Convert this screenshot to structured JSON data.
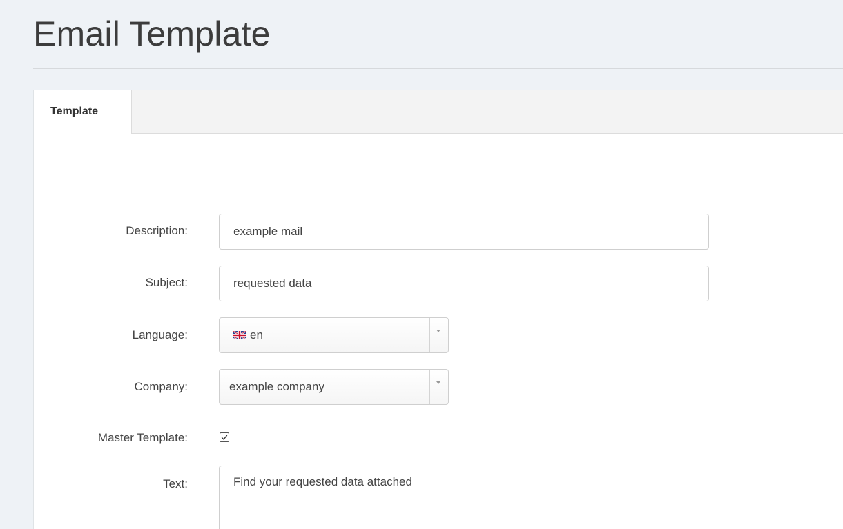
{
  "page": {
    "title": "Email Template"
  },
  "tabs": [
    {
      "label": "Template",
      "active": true
    }
  ],
  "form": {
    "description": {
      "label": "Description:",
      "value": "example mail"
    },
    "subject": {
      "label": "Subject:",
      "value": "requested data"
    },
    "language": {
      "label": "Language:",
      "value": "en",
      "flag_icon": "uk-flag-icon"
    },
    "company": {
      "label": "Company:",
      "value": "example company"
    },
    "master_template": {
      "label": "Master Template:",
      "checked": true
    },
    "text": {
      "label": "Text:",
      "value": "Find your requested data attached"
    }
  },
  "colors": {
    "background": "#eef2f6",
    "panel": "#ffffff",
    "tab_strip": "#f3f3f3",
    "border": "#cfcfcf"
  }
}
